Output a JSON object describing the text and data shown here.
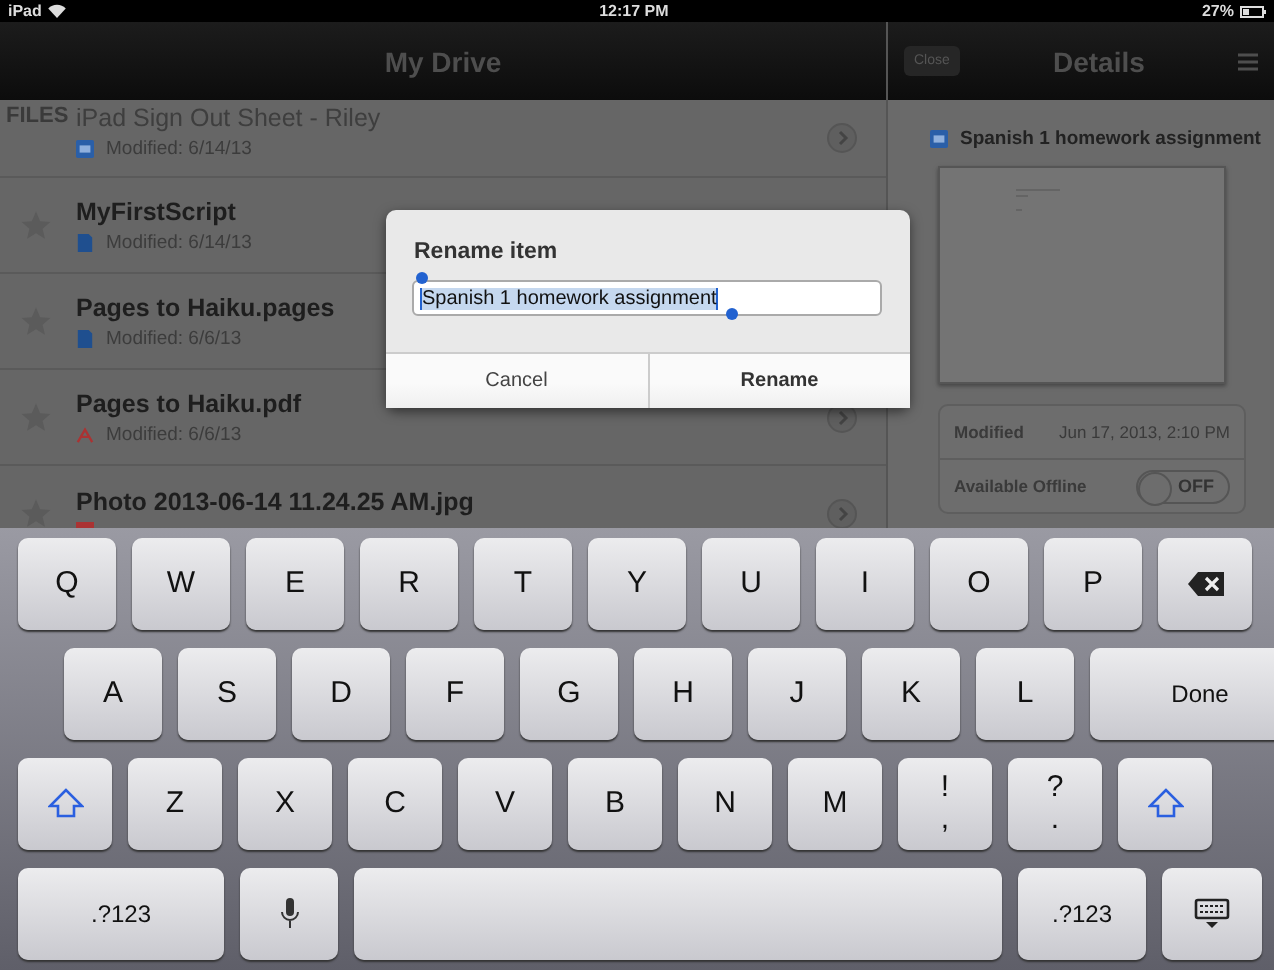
{
  "status_bar": {
    "device": "iPad",
    "time": "12:17 PM",
    "battery": "27%"
  },
  "drive": {
    "title": "My Drive",
    "section": "FILES",
    "files": [
      {
        "name": "iPad Sign Out Sheet - Riley",
        "modified": "Modified: 6/14/13",
        "kind": "slides",
        "scrolled_under": true
      },
      {
        "name": "MyFirstScript",
        "modified": "Modified: 6/14/13",
        "kind": "doc",
        "scrolled_under": false
      },
      {
        "name": "Pages to Haiku.pages",
        "modified": "Modified: 6/6/13",
        "kind": "doc",
        "scrolled_under": false
      },
      {
        "name": "Pages to Haiku.pdf",
        "modified": "Modified: 6/6/13",
        "kind": "pdf",
        "scrolled_under": false
      },
      {
        "name": "Photo 2013-06-14 11.24.25 AM.jpg",
        "kind": "image",
        "scrolled_under": false
      }
    ]
  },
  "details": {
    "close": "Close",
    "title": "Details",
    "file": {
      "name": "Spanish 1 homework assignment",
      "kind": "slides"
    },
    "modified_label": "Modified",
    "modified_value": "Jun 17, 2013, 2:10 PM",
    "offline_label": "Available Offline",
    "offline_on": false,
    "toggle_text": "OFF"
  },
  "dialog": {
    "title": "Rename item",
    "value": "Spanish 1 homework assignment",
    "all_selected": true,
    "buttons": [
      {
        "label": "Cancel",
        "kind": "cancel"
      },
      {
        "label": "Rename",
        "kind": "default"
      }
    ]
  },
  "keyboard": {
    "rows": [
      [
        {
          "kind": "letter",
          "label": "Q"
        },
        {
          "kind": "letter",
          "label": "W"
        },
        {
          "kind": "letter",
          "label": "E"
        },
        {
          "kind": "letter",
          "label": "R"
        },
        {
          "kind": "letter",
          "label": "T"
        },
        {
          "kind": "letter",
          "label": "Y"
        },
        {
          "kind": "letter",
          "label": "U"
        },
        {
          "kind": "letter",
          "label": "I"
        },
        {
          "kind": "letter",
          "label": "O"
        },
        {
          "kind": "letter",
          "label": "P"
        },
        {
          "kind": "delete"
        }
      ],
      [
        {
          "kind": "letter",
          "label": "A"
        },
        {
          "kind": "letter",
          "label": "S"
        },
        {
          "kind": "letter",
          "label": "D"
        },
        {
          "kind": "letter",
          "label": "F"
        },
        {
          "kind": "letter",
          "label": "G"
        },
        {
          "kind": "letter",
          "label": "H"
        },
        {
          "kind": "letter",
          "label": "J"
        },
        {
          "kind": "letter",
          "label": "K"
        },
        {
          "kind": "letter",
          "label": "L"
        },
        {
          "kind": "done",
          "label": "Done"
        }
      ],
      [
        {
          "kind": "shift"
        },
        {
          "kind": "letter",
          "label": "Z"
        },
        {
          "kind": "letter",
          "label": "X"
        },
        {
          "kind": "letter",
          "label": "C"
        },
        {
          "kind": "letter",
          "label": "V"
        },
        {
          "kind": "letter",
          "label": "B"
        },
        {
          "kind": "letter",
          "label": "N"
        },
        {
          "kind": "letter",
          "label": "M"
        },
        {
          "kind": "dual",
          "top": "!",
          "bottom": ","
        },
        {
          "kind": "dual",
          "top": "?",
          "bottom": "."
        },
        {
          "kind": "shift"
        }
      ],
      [
        {
          "kind": "mode",
          "label": ".?123"
        },
        {
          "kind": "mic"
        },
        {
          "kind": "space"
        },
        {
          "kind": "mode2",
          "label": ".?123"
        },
        {
          "kind": "hide"
        }
      ]
    ]
  }
}
